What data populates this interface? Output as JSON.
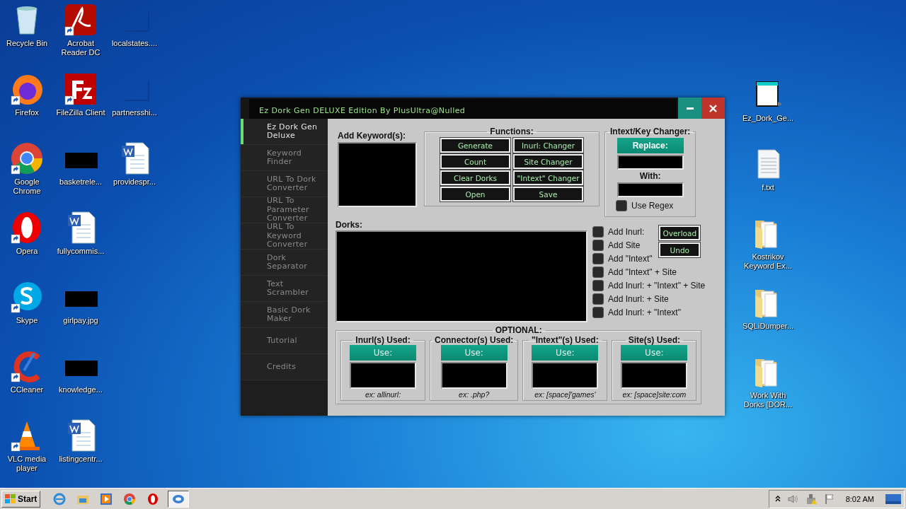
{
  "desktop": {
    "columns": [
      {
        "icons": [
          {
            "label": "Recycle Bin",
            "kind": "recycle-bin",
            "shortcut": false
          },
          {
            "label": "Firefox",
            "kind": "firefox",
            "shortcut": true
          },
          {
            "label": "Google Chrome",
            "kind": "chrome",
            "shortcut": true
          },
          {
            "label": "Opera",
            "kind": "opera",
            "shortcut": true
          },
          {
            "label": "Skype",
            "kind": "skype",
            "shortcut": true
          },
          {
            "label": "CCleaner",
            "kind": "ccleaner",
            "shortcut": true
          },
          {
            "label": "VLC media player",
            "kind": "vlc",
            "shortcut": true
          }
        ]
      },
      {
        "icons": [
          {
            "label": "Acrobat Reader DC",
            "kind": "pdf",
            "shortcut": true
          },
          {
            "label": "FileZilla Client",
            "kind": "filezilla",
            "shortcut": true
          },
          {
            "label": "basketrele...",
            "kind": "thumbnail",
            "shortcut": false
          },
          {
            "label": "fullycommis...",
            "kind": "word",
            "shortcut": false
          },
          {
            "label": "girlpay.jpg",
            "kind": "thumbnail",
            "shortcut": false
          },
          {
            "label": "knowledge...",
            "kind": "thumbnail",
            "shortcut": false
          },
          {
            "label": "listingcentr...",
            "kind": "word",
            "shortcut": false
          }
        ]
      },
      {
        "icons": [
          {
            "label": "localstates....",
            "kind": "blank",
            "shortcut": false
          },
          {
            "label": "partnersshi...",
            "kind": "blank",
            "shortcut": false
          },
          {
            "label": "providespr...",
            "kind": "word",
            "shortcut": false
          }
        ]
      }
    ],
    "right_column": [
      {
        "label": "Ez_Dork_Ge...",
        "kind": "app",
        "shortcut": false
      },
      {
        "label": "f.txt",
        "kind": "text",
        "shortcut": false
      },
      {
        "label": "Kostrikov Keyword Ex...",
        "kind": "folder",
        "shortcut": false
      },
      {
        "label": "SQLiDumper...",
        "kind": "folder",
        "shortcut": false
      },
      {
        "label": "Work With Dorks [DOR...",
        "kind": "folder",
        "shortcut": false
      }
    ]
  },
  "window": {
    "title": "Ez Dork Gen DELUXE Edition By PlusUltra@Nulled",
    "sidebar": [
      {
        "label": "Ez Dork Gen Deluxe",
        "selected": true
      },
      {
        "label": "Keyword Finder",
        "selected": false
      },
      {
        "label": "URL To Dork Converter",
        "selected": false
      },
      {
        "label": "URL To Parameter Converter",
        "selected": false
      },
      {
        "label": "URL To Keyword Converter",
        "selected": false
      },
      {
        "label": "Dork Separator",
        "selected": false
      },
      {
        "label": "Text Scrambler",
        "selected": false
      },
      {
        "label": "Basic Dork Maker",
        "selected": false
      },
      {
        "label": "Tutorial",
        "selected": false
      },
      {
        "label": "Credits",
        "selected": false
      }
    ],
    "keywords_label": "Add Keyword(s):",
    "functions": {
      "title": "Functions:",
      "buttons": [
        "Generate",
        "Inurl: Changer",
        "Count",
        "Site Changer",
        "Clear Dorks",
        "\"Intext\" Changer",
        "Open",
        "Save"
      ]
    },
    "changer": {
      "title": "Intext/Key Changer:",
      "replace_button": "Replace:",
      "with_label": "With:",
      "regex": {
        "label": "Use Regex",
        "checked": false
      }
    },
    "dorks_label": "Dorks:",
    "options": [
      {
        "label": "Add Inurl:",
        "checked": false
      },
      {
        "label": "Add Site",
        "checked": false
      },
      {
        "label": "Add \"Intext\"",
        "checked": false
      },
      {
        "label": "Add \"Intext\" + Site",
        "checked": false
      },
      {
        "label": "Add Inurl: + \"Intext\" + Site",
        "checked": false
      },
      {
        "label": "Add Inurl: + Site",
        "checked": false
      },
      {
        "label": "Add Inurl: + \"Intext\"",
        "checked": false
      }
    ],
    "side_buttons": [
      "Overload",
      "Undo"
    ],
    "optional": {
      "title": "OPTIONAL:",
      "groups": [
        {
          "title": "Inurl(s) Used:",
          "button": "Use:",
          "hint": "ex: allinurl:"
        },
        {
          "title": "Connector(s) Used:",
          "button": "Use:",
          "hint": "ex: .php?"
        },
        {
          "title": "\"Intext\"(s) Used:",
          "button": "Use:",
          "hint": "ex: [space]'games'"
        },
        {
          "title": "Site(s) Used:",
          "button": "Use:",
          "hint": "ex: [space]site:com"
        }
      ]
    }
  },
  "taskbar": {
    "start": "Start",
    "quick_launch": [
      {
        "kind": "ie"
      },
      {
        "kind": "explorer"
      },
      {
        "kind": "media"
      },
      {
        "kind": "chrome"
      },
      {
        "kind": "opera"
      }
    ],
    "tasks": [
      {
        "kind": "app",
        "selected": true
      }
    ],
    "clock": "8:02 AM"
  }
}
